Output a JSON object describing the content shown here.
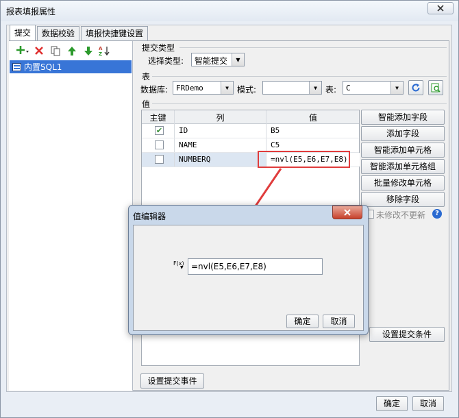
{
  "window": {
    "title": "报表填报属性",
    "close_icon": "close-icon"
  },
  "tabs": [
    "提交",
    "数据校验",
    "填报快捷键设置"
  ],
  "left_pane": {
    "toolbar_icons": [
      "add-icon",
      "delete-icon",
      "copy-icon",
      "move-up-icon",
      "move-down-icon",
      "sort-icon"
    ],
    "items": [
      {
        "label": "内置SQL1",
        "selected": true
      }
    ]
  },
  "submit_type": {
    "section": "提交类型",
    "label": "选择类型:",
    "value": "智能提交"
  },
  "table_section": {
    "section": "表",
    "db_label": "数据库:",
    "db_value": "FRDemo",
    "mode_label": "模式:",
    "mode_value": "",
    "table_label": "表:",
    "table_value": "C"
  },
  "values_section": {
    "section": "值",
    "headers": [
      "主键",
      "列",
      "值"
    ],
    "rows": [
      {
        "key": true,
        "column": "ID",
        "value": "B5"
      },
      {
        "key": false,
        "column": "NAME",
        "value": "C5"
      },
      {
        "key": false,
        "column": "NUMBERQ",
        "value": "=nvl(E5,E6,E7,E8)"
      }
    ]
  },
  "right_buttons": [
    "智能添加字段",
    "添加字段",
    "智能添加单元格",
    "智能添加单元格组",
    "批量修改单元格",
    "移除字段"
  ],
  "unchanged_label": "未修改不更新",
  "set_condition_label": "设置提交条件",
  "set_event_label": "设置提交事件",
  "footer": {
    "ok": "确定",
    "cancel": "取消"
  },
  "dialog": {
    "title": "值编辑器",
    "fx_label": "F(x)",
    "formula": "=nvl(E5,E6,E7,E8)",
    "ok": "确定",
    "cancel": "取消"
  },
  "colors": {
    "highlight": "#3875d7",
    "annotation": "#e03c3c",
    "check": "#2f8a2f"
  }
}
